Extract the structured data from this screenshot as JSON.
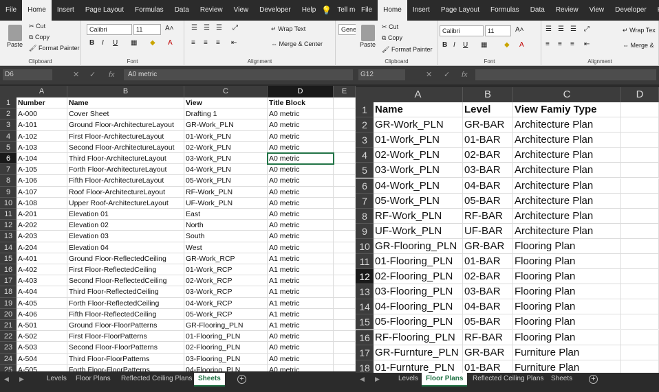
{
  "left": {
    "tabs": [
      "File",
      "Home",
      "Insert",
      "Page Layout",
      "Formulas",
      "Data",
      "Review",
      "View",
      "Developer",
      "Help"
    ],
    "active_tab": "Home",
    "tell_me": "Tell me what y",
    "clipboard": {
      "paste": "Paste",
      "cut": "Cut",
      "copy": "Copy",
      "format_painter": "Format Painter",
      "label": "Clipboard"
    },
    "font": {
      "name": "Calibri",
      "size": "11",
      "label": "Font"
    },
    "alignment": {
      "wrap": "Wrap Text",
      "merge": "Merge & Center",
      "label": "Alignment"
    },
    "number_format": "Gene",
    "name_box": "D6",
    "formula": "A0 metric",
    "columns": [
      "A",
      "B",
      "C",
      "D",
      "E"
    ],
    "header": {
      "n": "1",
      "cells": [
        "Number",
        "Name",
        "View",
        "Title Block"
      ]
    },
    "rows": [
      {
        "n": "2",
        "cells": [
          "A-000",
          "Cover Sheet",
          "Drafting 1",
          "A0 metric"
        ]
      },
      {
        "n": "3",
        "cells": [
          "A-101",
          "Ground Floor-ArchitectureLayout",
          "GR-Work_PLN",
          "A0 metric"
        ]
      },
      {
        "n": "4",
        "cells": [
          "A-102",
          "First Floor-ArchitectureLayout",
          "01-Work_PLN",
          "A0 metric"
        ]
      },
      {
        "n": "5",
        "cells": [
          "A-103",
          "Second Floor-ArchitectureLayout",
          "02-Work_PLN",
          "A0 metric"
        ]
      },
      {
        "n": "6",
        "cells": [
          "A-104",
          "Third Floor-ArchitectureLayout",
          "03-Work_PLN",
          "A0 metric"
        ]
      },
      {
        "n": "7",
        "cells": [
          "A-105",
          "Forth Floor-ArchitectureLayout",
          "04-Work_PLN",
          "A0 metric"
        ]
      },
      {
        "n": "8",
        "cells": [
          "A-106",
          "Fifth Floor-ArchitectureLayout",
          "05-Work_PLN",
          "A0 metric"
        ]
      },
      {
        "n": "9",
        "cells": [
          "A-107",
          "Roof Floor-ArchitectureLayout",
          "RF-Work_PLN",
          "A0 metric"
        ]
      },
      {
        "n": "10",
        "cells": [
          "A-108",
          "Upper Roof-ArchitectureLayout",
          "UF-Work_PLN",
          "A0 metric"
        ]
      },
      {
        "n": "11",
        "cells": [
          "A-201",
          "Elevation 01",
          "East",
          "A0 metric"
        ]
      },
      {
        "n": "12",
        "cells": [
          "A-202",
          "Elevation 02",
          "North",
          "A0 metric"
        ]
      },
      {
        "n": "13",
        "cells": [
          "A-203",
          "Elevation 03",
          "South",
          "A0 metric"
        ]
      },
      {
        "n": "14",
        "cells": [
          "A-204",
          "Elevation 04",
          "West",
          "A0 metric"
        ]
      },
      {
        "n": "15",
        "cells": [
          "A-401",
          "Ground Floor-ReflectedCeiling",
          "GR-Work_RCP",
          "A1 metric"
        ]
      },
      {
        "n": "16",
        "cells": [
          "A-402",
          "First Floor-ReflectedCeiling",
          "01-Work_RCP",
          "A1 metric"
        ]
      },
      {
        "n": "17",
        "cells": [
          "A-403",
          "Second Floor-ReflectedCeiling",
          "02-Work_RCP",
          "A1 metric"
        ]
      },
      {
        "n": "18",
        "cells": [
          "A-404",
          "Third Floor-ReflectedCeiling",
          "03-Work_RCP",
          "A1 metric"
        ]
      },
      {
        "n": "19",
        "cells": [
          "A-405",
          "Forth Floor-ReflectedCeiling",
          "04-Work_RCP",
          "A1 metric"
        ]
      },
      {
        "n": "20",
        "cells": [
          "A-406",
          "Fifth Floor-ReflectedCeiling",
          "05-Work_RCP",
          "A1 metric"
        ]
      },
      {
        "n": "21",
        "cells": [
          "A-501",
          "Ground Floor-FloorPatterns",
          "GR-Flooring_PLN",
          "A1 metric"
        ]
      },
      {
        "n": "22",
        "cells": [
          "A-502",
          "First Floor-FloorPatterns",
          "01-Flooring_PLN",
          "A0 metric"
        ]
      },
      {
        "n": "23",
        "cells": [
          "A-503",
          "Second Floor-FloorPatterns",
          "02-Flooring_PLN",
          "A0 metric"
        ]
      },
      {
        "n": "24",
        "cells": [
          "A-504",
          "Third Floor-FloorPatterns",
          "03-Flooring_PLN",
          "A0 metric"
        ]
      },
      {
        "n": "25",
        "cells": [
          "A-505",
          "Forth Floor-FloorPatterns",
          "04-Flooring_PLN",
          "A0 metric"
        ]
      }
    ],
    "sheets": [
      "Levels",
      "Floor Plans",
      "Reflected Ceiling Plans",
      "Sheets"
    ],
    "active_sheet": "Sheets"
  },
  "right": {
    "tabs": [
      "File",
      "Home",
      "Insert",
      "Page Layout",
      "Formulas",
      "Data",
      "Review",
      "View",
      "Developer",
      "Help"
    ],
    "active_tab": "Home",
    "clipboard": {
      "paste": "Paste",
      "cut": "Cut",
      "copy": "Copy",
      "format_painter": "Format Painter",
      "label": "Clipboard"
    },
    "font": {
      "name": "Calibri",
      "size": "11",
      "label": "Font"
    },
    "alignment": {
      "wrap": "Wrap Tex",
      "merge": "Merge &",
      "label": "Alignment"
    },
    "name_box": "G12",
    "formula": "",
    "columns": [
      "A",
      "B",
      "C",
      "D"
    ],
    "header": {
      "n": "1",
      "cells": [
        "Name",
        "Level",
        "View Famiy Type"
      ]
    },
    "rows": [
      {
        "n": "2",
        "cells": [
          "GR-Work_PLN",
          "GR-BAR",
          "Architecture Plan"
        ]
      },
      {
        "n": "3",
        "cells": [
          "01-Work_PLN",
          "01-BAR",
          "Architecture Plan"
        ]
      },
      {
        "n": "4",
        "cells": [
          "02-Work_PLN",
          "02-BAR",
          "Architecture Plan"
        ]
      },
      {
        "n": "5",
        "cells": [
          "03-Work_PLN",
          "03-BAR",
          "Architecture Plan"
        ]
      },
      {
        "n": "6",
        "cells": [
          "04-Work_PLN",
          "04-BAR",
          "Architecture Plan"
        ]
      },
      {
        "n": "7",
        "cells": [
          "05-Work_PLN",
          "05-BAR",
          "Architecture Plan"
        ]
      },
      {
        "n": "8",
        "cells": [
          "RF-Work_PLN",
          "RF-BAR",
          "Architecture Plan"
        ]
      },
      {
        "n": "9",
        "cells": [
          "UF-Work_PLN",
          "UF-BAR",
          "Architecture Plan"
        ]
      },
      {
        "n": "10",
        "cells": [
          "GR-Flooring_PLN",
          "GR-BAR",
          "Flooring Plan"
        ]
      },
      {
        "n": "11",
        "cells": [
          "01-Flooring_PLN",
          "01-BAR",
          "Flooring Plan"
        ]
      },
      {
        "n": "12",
        "cells": [
          "02-Flooring_PLN",
          "02-BAR",
          "Flooring Plan"
        ]
      },
      {
        "n": "13",
        "cells": [
          "03-Flooring_PLN",
          "03-BAR",
          "Flooring Plan"
        ]
      },
      {
        "n": "14",
        "cells": [
          "04-Flooring_PLN",
          "04-BAR",
          "Flooring Plan"
        ]
      },
      {
        "n": "15",
        "cells": [
          "05-Flooring_PLN",
          "05-BAR",
          "Flooring Plan"
        ]
      },
      {
        "n": "16",
        "cells": [
          "RF-Flooring_PLN",
          "RF-BAR",
          "Flooring Plan"
        ]
      },
      {
        "n": "17",
        "cells": [
          "GR-Furnture_PLN",
          "GR-BAR",
          "Furniture Plan"
        ]
      },
      {
        "n": "18",
        "cells": [
          "01-Furnture_PLN",
          "01-BAR",
          "Furniture Plan"
        ]
      }
    ],
    "sheets": [
      "Levels",
      "Floor Plans",
      "Reflected Ceiling Plans",
      "Sheets"
    ],
    "active_sheet": "Floor Plans"
  },
  "colors": {
    "accent": "#217346",
    "dark": "#2b2b2b"
  }
}
